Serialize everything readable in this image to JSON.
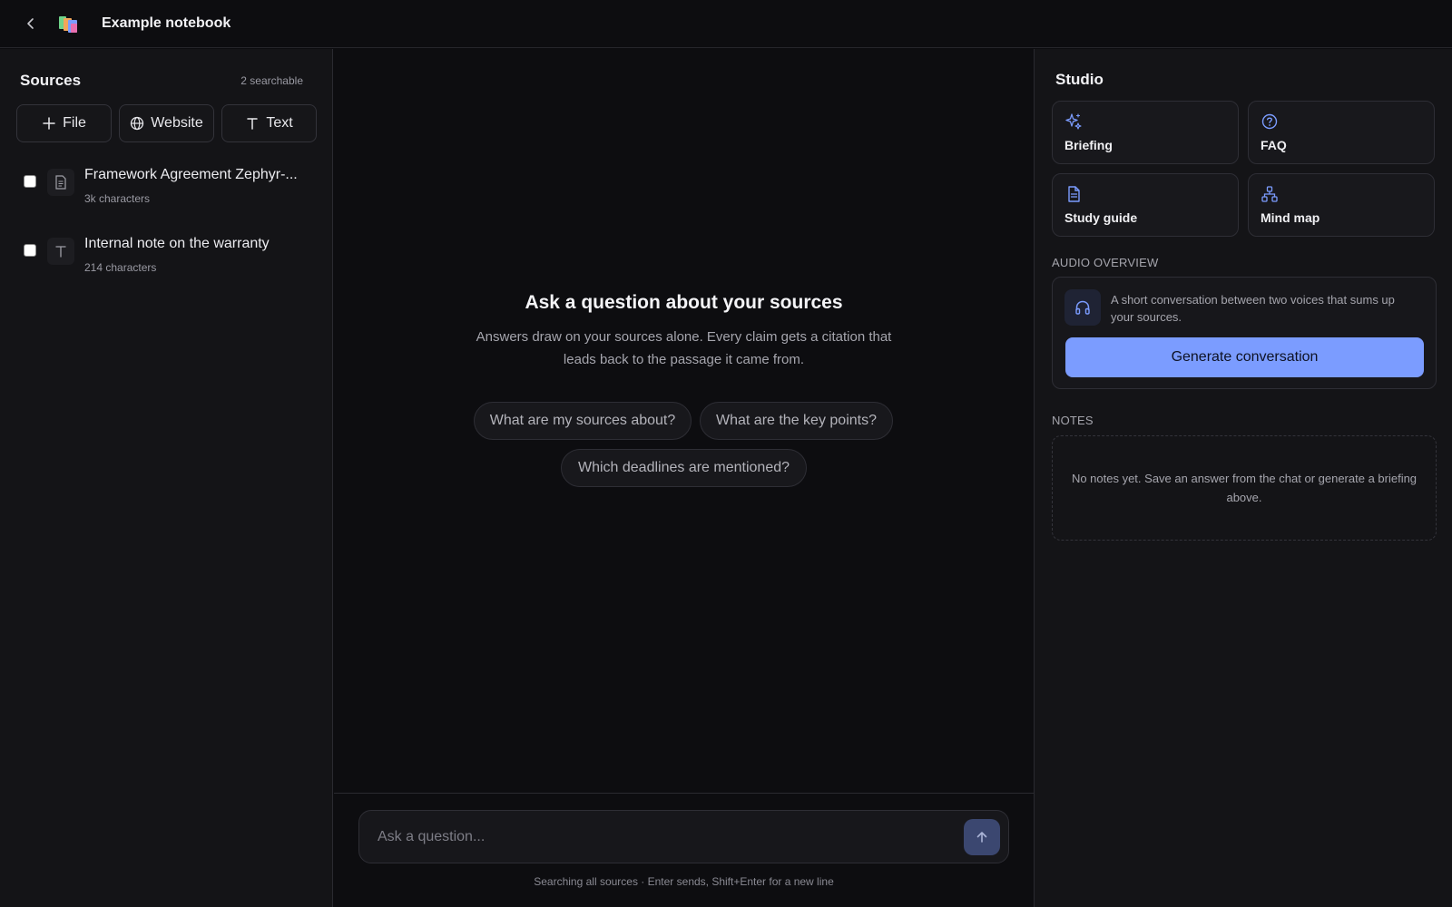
{
  "header": {
    "title": "Example notebook"
  },
  "sources": {
    "title": "Sources",
    "count": "2 searchable",
    "add_file": "File",
    "add_website": "Website",
    "add_text": "Text",
    "items": [
      {
        "name": "Framework Agreement Zephyr-...",
        "meta": "3k characters"
      },
      {
        "name": "Internal note on the warranty",
        "meta": "214 characters"
      }
    ]
  },
  "chat": {
    "empty_title": "Ask a question about your sources",
    "empty_subtitle": "Answers draw on your sources alone. Every claim gets a citation that leads back to the passage it came from.",
    "suggestions": [
      "What are my sources about?",
      "What are the key points?",
      "Which deadlines are mentioned?"
    ],
    "input_placeholder": "Ask a question...",
    "hint": "Searching all sources · Enter sends, Shift+Enter for a new line"
  },
  "studio": {
    "title": "Studio",
    "tiles": [
      {
        "label": "Briefing",
        "icon": "sparkles-icon"
      },
      {
        "label": "FAQ",
        "icon": "help-circle-icon"
      },
      {
        "label": "Study guide",
        "icon": "document-icon"
      },
      {
        "label": "Mind map",
        "icon": "network-icon"
      }
    ],
    "audio_label": "AUDIO OVERVIEW",
    "audio_desc": "A short conversation between two voices that sums up your sources.",
    "audio_button": "Generate conversation",
    "notes_label": "NOTES",
    "notes_empty": "No notes yet. Save an answer from the chat or generate a briefing above."
  },
  "colors": {
    "accent": "#7b9cff",
    "background": "#0d0d10",
    "panel": "#141417"
  }
}
